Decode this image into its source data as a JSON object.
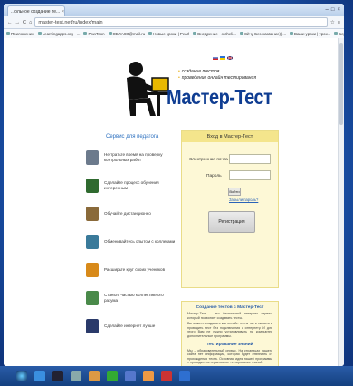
{
  "browser": {
    "tab_title": "...ольное создание те...",
    "tab_close": "×",
    "url": "master-test.net/ru/index/main",
    "nav_back": "←",
    "nav_forward": "→",
    "nav_reload": "C",
    "home": "⌂",
    "star": "☆",
    "menu": "≡",
    "win_min": "–",
    "win_max": "□",
    "win_close": "×"
  },
  "bookmarks": [
    "Приложения",
    "Learningapps.org - ...",
    "PowToon",
    "ОБЛАКО@mail.ru",
    "Новые уроки | Pearl",
    "Внедрение - otcheli...",
    "Эйчу Без название) |...",
    "Ваши уроки | урок...",
    "Березникова Анжела..."
  ],
  "site": {
    "bullets": [
      "создание тестов",
      "проведение онлайн тестирования"
    ],
    "logo": "Мастер-Тест",
    "services_title": "Сервис для педагога",
    "services": [
      "Не тратьте время на проверку контрольных работ",
      "Сделайте процесс обучения интересным",
      "Обучайте дистанционно",
      "Обменивайтесь опытом с коллегами",
      "Расширьте круг своих учеников",
      "Станьте частью коллективного разума",
      "Сделайте интернет лучше"
    ]
  },
  "login": {
    "title": "Вход в Мастер-Тест",
    "email_label": "Электронная почта",
    "password_label": "Пароль",
    "submit": "Войти",
    "forgot": "Забыли пароль?",
    "register": "Регистрация"
  },
  "info": {
    "title": "Создание тестов с Мастер-Тест",
    "p1": "Мастер-Тест – это бесплатный интернет сервис, который позволяет создавать тесты.",
    "p2": "Вы можете создавать как онлайн тесты так и скачать и проводить тест без подключения к интернету. И для этого Вам не нужно устанавливать на компьютер дополнительные программы.",
    "title2": "Тестирование знаний",
    "p3": "Мы – образовательный сервис. На страницах нашего сайта нет информации, которая будет отвлекать от прохождения теста. Основная идея нашей программы – проводить интерактивное тестирование знаний."
  },
  "colors": {
    "logo": "#0f3d92",
    "panel_bg": "#fdf8d6",
    "panel_header": "#f4e58c",
    "frame": "#1c56b0"
  }
}
